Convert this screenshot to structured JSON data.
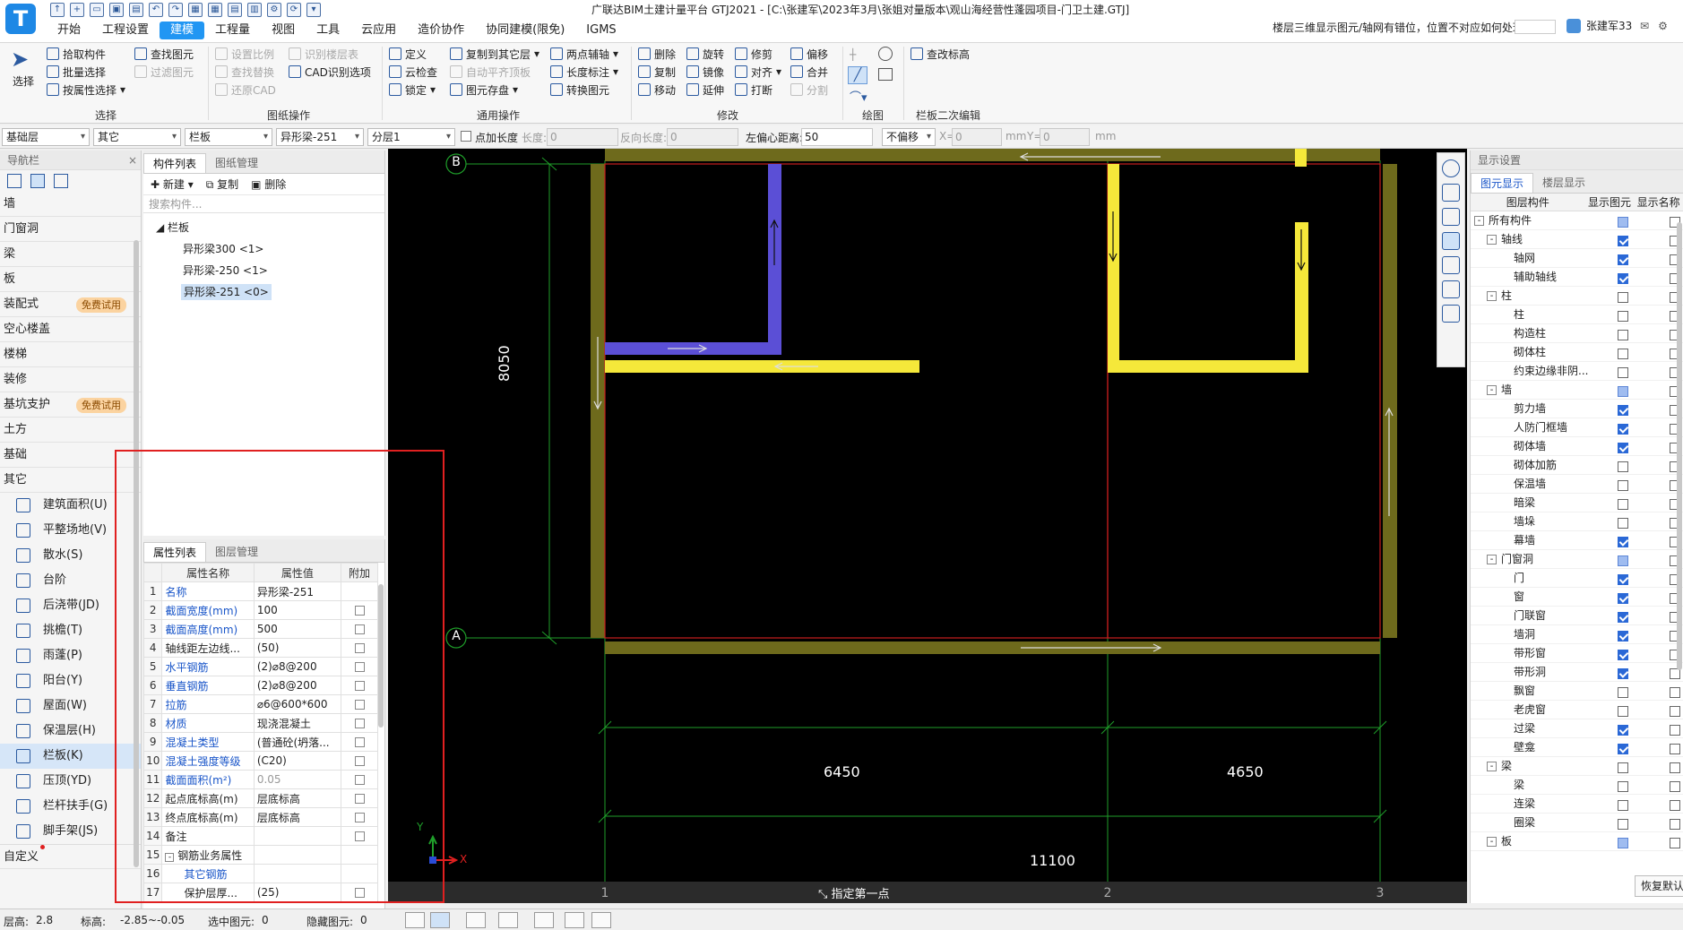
{
  "app": {
    "title": "广联达BIM土建计量平台 GTJ2021 - [C:\\张建军\\2023年3月\\张姐对量版本\\观山海经营性蓬园项目-门卫土建.GTJ]",
    "help_question": "楼层三维显示图元/轴网有错位，位置不对应如何处理?",
    "user": "张建军33",
    "logo": "T"
  },
  "menu": [
    "开始",
    "工程设置",
    "建模",
    "工程量",
    "视图",
    "工具",
    "云应用",
    "造价协作",
    "协同建模(限免)",
    "IGMS"
  ],
  "ribbon": {
    "select": {
      "label": "选择",
      "pick": "拾取构件",
      "batch": "批量选择",
      "by_attr": "按属性选择",
      "group": "选择"
    },
    "drawing_ops": {
      "find": "查找图元",
      "filter": "过滤图元",
      "set_scale": "设置比例",
      "find_replace": "查找替换",
      "restore_cad": "还原CAD",
      "recog_floor": "识别楼层表",
      "cad_recog": "CAD识别选项",
      "group": "图纸操作"
    },
    "general_ops": {
      "define": "定义",
      "cloud_check": "云检查",
      "lock": "锁定",
      "copy_to_floor": "复制到其它层",
      "auto_align": "自动平齐顶板",
      "elem_save": "图元存盘",
      "two_point_axis": "两点辅轴",
      "length_mark": "长度标注",
      "convert": "转换图元",
      "group": "通用操作"
    },
    "modify": {
      "delete": "删除",
      "rotate": "旋转",
      "trim": "修剪",
      "offset": "偏移",
      "copy": "复制",
      "mirror": "镜像",
      "align": "对齐",
      "merge": "合并",
      "move": "移动",
      "extend": "延伸",
      "break": "打断",
      "split": "分割",
      "group": "修改"
    },
    "draw": {
      "group": "绘图"
    },
    "rail_edit": {
      "check_elev": "查改标高",
      "group": "栏板二次编辑"
    }
  },
  "propbar": {
    "floor": "基础层",
    "type": "其它",
    "component": "栏板",
    "spec": "异形梁-251",
    "layer": "分层1",
    "point_length": "点加长度",
    "length_lbl": "长度:",
    "length_val": "0",
    "reverse_lbl": "反向长度:",
    "reverse_val": "0",
    "offset_lbl": "左偏心距离:",
    "offset_val": "50",
    "no_offset": "不偏移",
    "x_lbl": "X=",
    "x_val": "0",
    "mm1": "mm",
    "y_lbl": "Y=",
    "y_val": "0",
    "mm2": "mm"
  },
  "nav": {
    "title": "导航栏",
    "items": [
      "墙",
      "门窗洞",
      "梁",
      "板",
      "装配式",
      "空心楼盖",
      "楼梯",
      "装修",
      "基坑支护",
      "土方",
      "基础",
      "其它"
    ],
    "trial_badge": "免费试用",
    "sub_items": [
      "建筑面积(U)",
      "平整场地(V)",
      "散水(S)",
      "台阶",
      "后浇带(JD)",
      "挑檐(T)",
      "雨蓬(P)",
      "阳台(Y)",
      "屋面(W)",
      "保温层(H)",
      "栏板(K)",
      "压顶(YD)",
      "栏杆扶手(G)",
      "脚手架(JS)"
    ],
    "custom": "自定义"
  },
  "component_panel": {
    "tabs": [
      "构件列表",
      "图纸管理"
    ],
    "toolbar": {
      "new": "新建",
      "copy": "复制",
      "delete": "删除"
    },
    "search_placeholder": "搜索构件...",
    "root": "栏板",
    "items": [
      "异形梁300 <1>",
      "异形梁-250 <1>",
      "异形梁-251 <0>"
    ]
  },
  "property_panel": {
    "tabs": [
      "属性列表",
      "图层管理"
    ],
    "headers": [
      "属性名称",
      "属性值",
      "附加"
    ],
    "rows": [
      {
        "n": "1",
        "k": "名称",
        "v": "异形梁-251"
      },
      {
        "n": "2",
        "k": "截面宽度(mm)",
        "v": "100"
      },
      {
        "n": "3",
        "k": "截面高度(mm)",
        "v": "500"
      },
      {
        "n": "4",
        "k": "轴线距左边线...",
        "v": "(50)"
      },
      {
        "n": "5",
        "k": "水平钢筋",
        "v": "(2)⌀8@200"
      },
      {
        "n": "6",
        "k": "垂直钢筋",
        "v": "(2)⌀8@200"
      },
      {
        "n": "7",
        "k": "拉筋",
        "v": "⌀6@600*600"
      },
      {
        "n": "8",
        "k": "材质",
        "v": "现浇混凝土"
      },
      {
        "n": "9",
        "k": "混凝土类型",
        "v": "(普通砼(坍落..."
      },
      {
        "n": "10",
        "k": "混凝土强度等级",
        "v": "(C20)"
      },
      {
        "n": "11",
        "k": "截面面积(m²)",
        "v": "0.05"
      },
      {
        "n": "12",
        "k": "起点底标高(m)",
        "v": "层底标高"
      },
      {
        "n": "13",
        "k": "终点底标高(m)",
        "v": "层底标高"
      },
      {
        "n": "14",
        "k": "备注",
        "v": ""
      },
      {
        "n": "15",
        "k": "钢筋业务属性",
        "v": ""
      },
      {
        "n": "16",
        "k": "其它钢筋",
        "v": ""
      },
      {
        "n": "17",
        "k": "保护层厚...",
        "v": "(25)"
      }
    ]
  },
  "canvas": {
    "axis_b": "B",
    "axis_a": "A",
    "axis_1": "1",
    "axis_2": "2",
    "axis_3": "3",
    "dim_vertical": "8050",
    "dim_6450": "6450",
    "dim_4650": "4650",
    "dim_total": "11100",
    "prompt": "指定第一点",
    "ucs_x": "X",
    "ucs_y": "Y"
  },
  "display_panel": {
    "title": "显示设置",
    "tabs": [
      "图元显示",
      "楼层显示"
    ],
    "headers": [
      "图层构件",
      "显示图元",
      "显示名称"
    ],
    "rows": [
      {
        "label": "所有构件",
        "lvl": 0,
        "exp": "-",
        "c1": "part"
      },
      {
        "label": "轴线",
        "lvl": 1,
        "exp": "-",
        "c1": "on"
      },
      {
        "label": "轴网",
        "lvl": 2,
        "c1": "on"
      },
      {
        "label": "辅助轴线",
        "lvl": 2,
        "c1": "on"
      },
      {
        "label": "柱",
        "lvl": 1,
        "exp": "-",
        "c1": "off"
      },
      {
        "label": "柱",
        "lvl": 2,
        "c1": "off"
      },
      {
        "label": "构造柱",
        "lvl": 2,
        "c1": "off"
      },
      {
        "label": "砌体柱",
        "lvl": 2,
        "c1": "off"
      },
      {
        "label": "约束边缘非阴...",
        "lvl": 2,
        "c1": "off"
      },
      {
        "label": "墙",
        "lvl": 1,
        "exp": "-",
        "c1": "part"
      },
      {
        "label": "剪力墙",
        "lvl": 2,
        "c1": "on"
      },
      {
        "label": "人防门框墙",
        "lvl": 2,
        "c1": "on"
      },
      {
        "label": "砌体墙",
        "lvl": 2,
        "c1": "on"
      },
      {
        "label": "砌体加筋",
        "lvl": 2,
        "c1": "off"
      },
      {
        "label": "保温墙",
        "lvl": 2,
        "c1": "off"
      },
      {
        "label": "暗梁",
        "lvl": 2,
        "c1": "off"
      },
      {
        "label": "墙垛",
        "lvl": 2,
        "c1": "off"
      },
      {
        "label": "幕墙",
        "lvl": 2,
        "c1": "on"
      },
      {
        "label": "门窗洞",
        "lvl": 1,
        "exp": "-",
        "c1": "part"
      },
      {
        "label": "门",
        "lvl": 2,
        "c1": "on"
      },
      {
        "label": "窗",
        "lvl": 2,
        "c1": "on"
      },
      {
        "label": "门联窗",
        "lvl": 2,
        "c1": "on"
      },
      {
        "label": "墙洞",
        "lvl": 2,
        "c1": "on"
      },
      {
        "label": "带形窗",
        "lvl": 2,
        "c1": "on"
      },
      {
        "label": "带形洞",
        "lvl": 2,
        "c1": "on"
      },
      {
        "label": "飘窗",
        "lvl": 2,
        "c1": "off"
      },
      {
        "label": "老虎窗",
        "lvl": 2,
        "c1": "off"
      },
      {
        "label": "过梁",
        "lvl": 2,
        "c1": "on"
      },
      {
        "label": "壁龛",
        "lvl": 2,
        "c1": "on"
      },
      {
        "label": "梁",
        "lvl": 1,
        "exp": "-",
        "c1": "off"
      },
      {
        "label": "梁",
        "lvl": 2,
        "c1": "off"
      },
      {
        "label": "连梁",
        "lvl": 2,
        "c1": "off"
      },
      {
        "label": "圈梁",
        "lvl": 2,
        "c1": "off"
      },
      {
        "label": "板",
        "lvl": 1,
        "exp": "-",
        "c1": "part"
      }
    ],
    "restore": "恢复默认"
  },
  "status": {
    "floor_height_lbl": "层高:",
    "floor_height": "2.8",
    "elev_lbl": "标高:",
    "elev": "-2.85~-0.05",
    "selected_lbl": "选中图元:",
    "selected": "0",
    "hidden_lbl": "隐藏图元:",
    "hidden": "0"
  },
  "colors": {
    "accent": "#2196f3",
    "rail_yellow": "#f5e83a",
    "rail_blue": "#5b4fd6",
    "wall_olive": "#6e6a1c",
    "axis_green": "#1f9e2a",
    "highlight_red": "#e02020"
  }
}
